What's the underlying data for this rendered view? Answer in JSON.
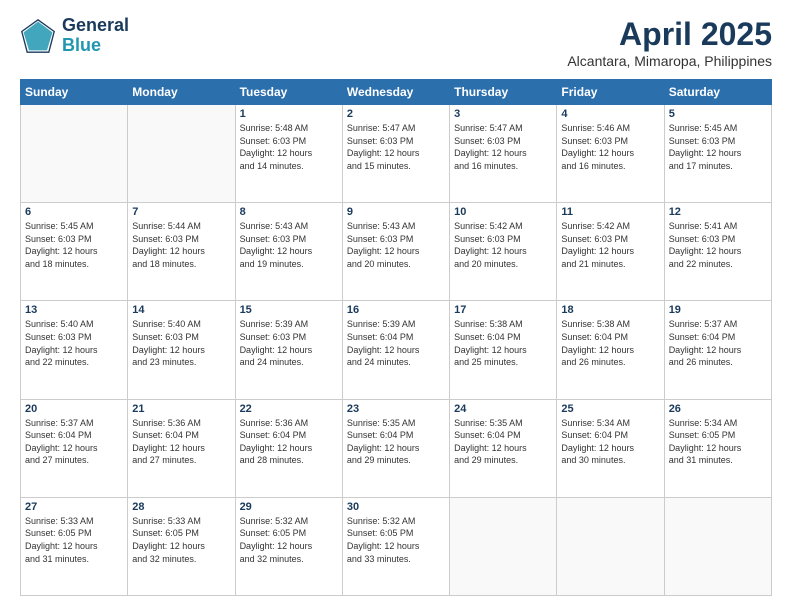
{
  "logo": {
    "line1": "General",
    "line2": "Blue"
  },
  "title": "April 2025",
  "subtitle": "Alcantara, Mimaropa, Philippines",
  "days_of_week": [
    "Sunday",
    "Monday",
    "Tuesday",
    "Wednesday",
    "Thursday",
    "Friday",
    "Saturday"
  ],
  "weeks": [
    [
      {
        "day": "",
        "info": ""
      },
      {
        "day": "",
        "info": ""
      },
      {
        "day": "1",
        "info": "Sunrise: 5:48 AM\nSunset: 6:03 PM\nDaylight: 12 hours\nand 14 minutes."
      },
      {
        "day": "2",
        "info": "Sunrise: 5:47 AM\nSunset: 6:03 PM\nDaylight: 12 hours\nand 15 minutes."
      },
      {
        "day": "3",
        "info": "Sunrise: 5:47 AM\nSunset: 6:03 PM\nDaylight: 12 hours\nand 16 minutes."
      },
      {
        "day": "4",
        "info": "Sunrise: 5:46 AM\nSunset: 6:03 PM\nDaylight: 12 hours\nand 16 minutes."
      },
      {
        "day": "5",
        "info": "Sunrise: 5:45 AM\nSunset: 6:03 PM\nDaylight: 12 hours\nand 17 minutes."
      }
    ],
    [
      {
        "day": "6",
        "info": "Sunrise: 5:45 AM\nSunset: 6:03 PM\nDaylight: 12 hours\nand 18 minutes."
      },
      {
        "day": "7",
        "info": "Sunrise: 5:44 AM\nSunset: 6:03 PM\nDaylight: 12 hours\nand 18 minutes."
      },
      {
        "day": "8",
        "info": "Sunrise: 5:43 AM\nSunset: 6:03 PM\nDaylight: 12 hours\nand 19 minutes."
      },
      {
        "day": "9",
        "info": "Sunrise: 5:43 AM\nSunset: 6:03 PM\nDaylight: 12 hours\nand 20 minutes."
      },
      {
        "day": "10",
        "info": "Sunrise: 5:42 AM\nSunset: 6:03 PM\nDaylight: 12 hours\nand 20 minutes."
      },
      {
        "day": "11",
        "info": "Sunrise: 5:42 AM\nSunset: 6:03 PM\nDaylight: 12 hours\nand 21 minutes."
      },
      {
        "day": "12",
        "info": "Sunrise: 5:41 AM\nSunset: 6:03 PM\nDaylight: 12 hours\nand 22 minutes."
      }
    ],
    [
      {
        "day": "13",
        "info": "Sunrise: 5:40 AM\nSunset: 6:03 PM\nDaylight: 12 hours\nand 22 minutes."
      },
      {
        "day": "14",
        "info": "Sunrise: 5:40 AM\nSunset: 6:03 PM\nDaylight: 12 hours\nand 23 minutes."
      },
      {
        "day": "15",
        "info": "Sunrise: 5:39 AM\nSunset: 6:03 PM\nDaylight: 12 hours\nand 24 minutes."
      },
      {
        "day": "16",
        "info": "Sunrise: 5:39 AM\nSunset: 6:04 PM\nDaylight: 12 hours\nand 24 minutes."
      },
      {
        "day": "17",
        "info": "Sunrise: 5:38 AM\nSunset: 6:04 PM\nDaylight: 12 hours\nand 25 minutes."
      },
      {
        "day": "18",
        "info": "Sunrise: 5:38 AM\nSunset: 6:04 PM\nDaylight: 12 hours\nand 26 minutes."
      },
      {
        "day": "19",
        "info": "Sunrise: 5:37 AM\nSunset: 6:04 PM\nDaylight: 12 hours\nand 26 minutes."
      }
    ],
    [
      {
        "day": "20",
        "info": "Sunrise: 5:37 AM\nSunset: 6:04 PM\nDaylight: 12 hours\nand 27 minutes."
      },
      {
        "day": "21",
        "info": "Sunrise: 5:36 AM\nSunset: 6:04 PM\nDaylight: 12 hours\nand 27 minutes."
      },
      {
        "day": "22",
        "info": "Sunrise: 5:36 AM\nSunset: 6:04 PM\nDaylight: 12 hours\nand 28 minutes."
      },
      {
        "day": "23",
        "info": "Sunrise: 5:35 AM\nSunset: 6:04 PM\nDaylight: 12 hours\nand 29 minutes."
      },
      {
        "day": "24",
        "info": "Sunrise: 5:35 AM\nSunset: 6:04 PM\nDaylight: 12 hours\nand 29 minutes."
      },
      {
        "day": "25",
        "info": "Sunrise: 5:34 AM\nSunset: 6:04 PM\nDaylight: 12 hours\nand 30 minutes."
      },
      {
        "day": "26",
        "info": "Sunrise: 5:34 AM\nSunset: 6:05 PM\nDaylight: 12 hours\nand 31 minutes."
      }
    ],
    [
      {
        "day": "27",
        "info": "Sunrise: 5:33 AM\nSunset: 6:05 PM\nDaylight: 12 hours\nand 31 minutes."
      },
      {
        "day": "28",
        "info": "Sunrise: 5:33 AM\nSunset: 6:05 PM\nDaylight: 12 hours\nand 32 minutes."
      },
      {
        "day": "29",
        "info": "Sunrise: 5:32 AM\nSunset: 6:05 PM\nDaylight: 12 hours\nand 32 minutes."
      },
      {
        "day": "30",
        "info": "Sunrise: 5:32 AM\nSunset: 6:05 PM\nDaylight: 12 hours\nand 33 minutes."
      },
      {
        "day": "",
        "info": ""
      },
      {
        "day": "",
        "info": ""
      },
      {
        "day": "",
        "info": ""
      }
    ]
  ]
}
